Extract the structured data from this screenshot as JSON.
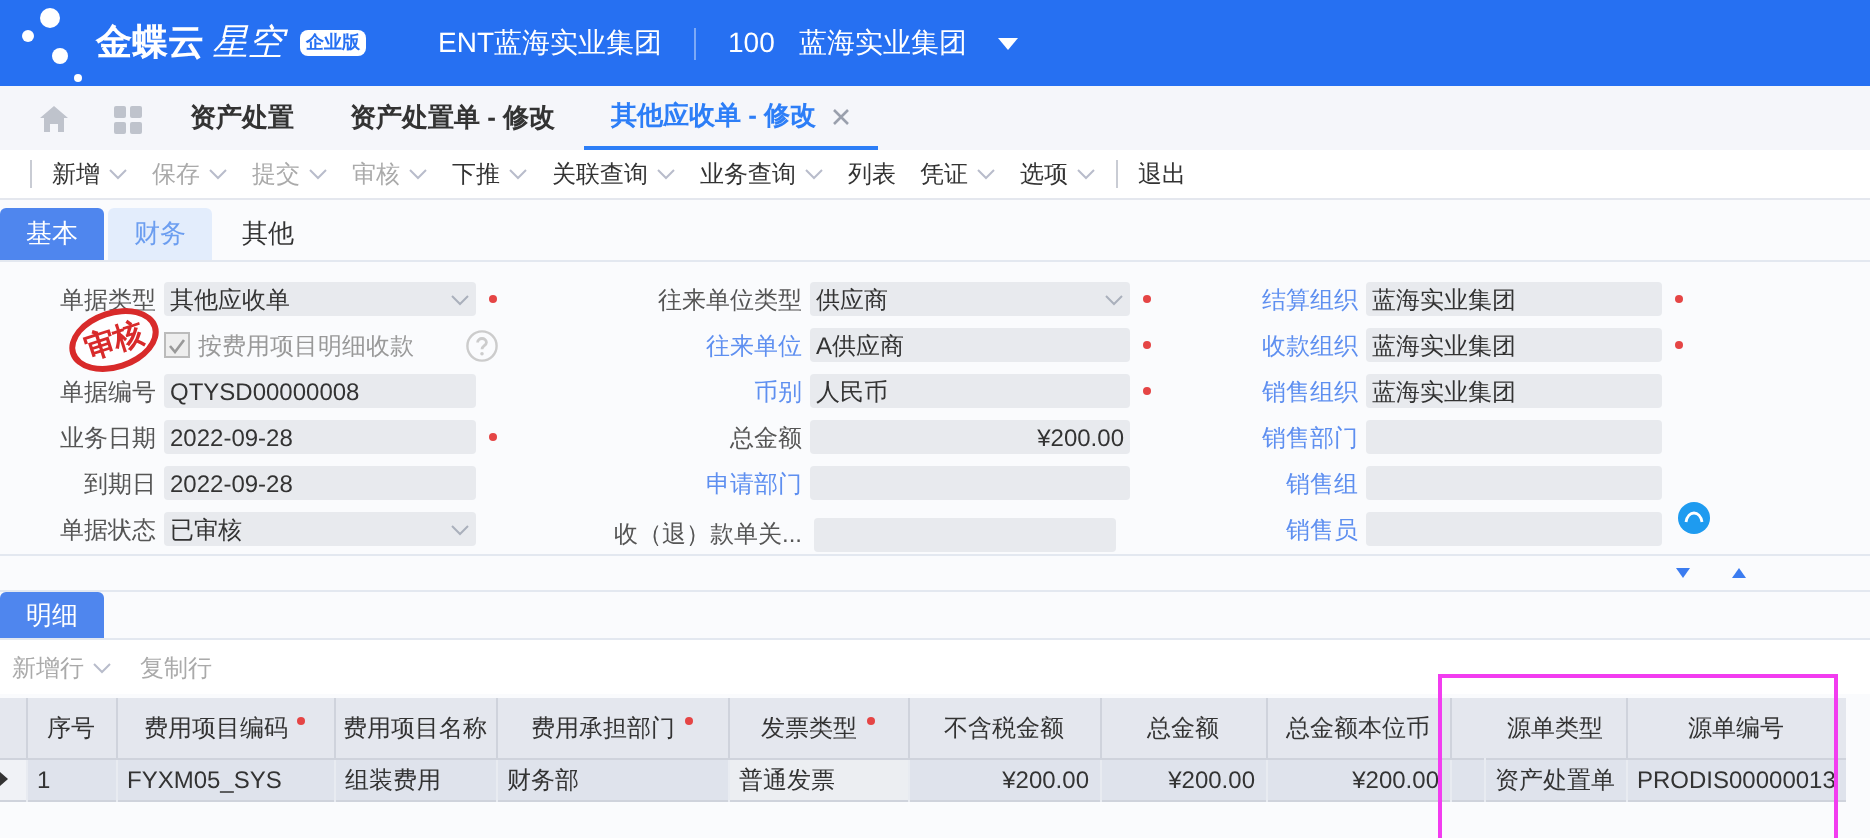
{
  "header": {
    "brand": "金蝶云",
    "product": "星空",
    "edition": "企业版",
    "tenant": "ENT蓝海实业集团",
    "org_code": "100",
    "org_name": "蓝海实业集团"
  },
  "page_tabs": [
    {
      "label": "资产处置",
      "selected": false
    },
    {
      "label": "资产处置单 - 修改",
      "selected": false
    },
    {
      "label": "其他应收单 - 修改",
      "selected": true
    }
  ],
  "toolbar": [
    {
      "label": "新增",
      "disabled": false,
      "dropdown": true
    },
    {
      "label": "保存",
      "disabled": true,
      "dropdown": true
    },
    {
      "label": "提交",
      "disabled": true,
      "dropdown": true
    },
    {
      "label": "审核",
      "disabled": true,
      "dropdown": true
    },
    {
      "label": "下推",
      "disabled": false,
      "dropdown": true
    },
    {
      "label": "关联查询",
      "disabled": false,
      "dropdown": true
    },
    {
      "label": "业务查询",
      "disabled": false,
      "dropdown": true
    },
    {
      "label": "列表",
      "disabled": false,
      "dropdown": false
    },
    {
      "label": "凭证",
      "disabled": false,
      "dropdown": true
    },
    {
      "label": "选项",
      "disabled": false,
      "dropdown": true
    },
    {
      "label": "退出",
      "disabled": false,
      "dropdown": false
    }
  ],
  "form_tabs": [
    {
      "label": "基本",
      "selected": true,
      "hover": false
    },
    {
      "label": "财务",
      "selected": false,
      "hover": true
    },
    {
      "label": "其他",
      "selected": false,
      "hover": false
    }
  ],
  "stamp": "审核",
  "form_columns": [
    [
      {
        "kind": "select",
        "label": "单据类型",
        "link": false,
        "value": "其他应收单",
        "required": true
      },
      {
        "kind": "checkbox",
        "label": "按费用项目明细收款",
        "checked": true
      },
      {
        "kind": "text",
        "label": "单据编号",
        "link": false,
        "value": "QTYSD00000008",
        "required": false
      },
      {
        "kind": "text",
        "label": "业务日期",
        "link": false,
        "value": "2022-09-28",
        "required": true
      },
      {
        "kind": "text",
        "label": "到期日",
        "link": false,
        "value": "2022-09-28",
        "required": false
      },
      {
        "kind": "select",
        "label": "单据状态",
        "link": false,
        "value": "已审核",
        "required": false
      }
    ],
    [
      {
        "kind": "select",
        "label": "往来单位类型",
        "link": false,
        "value": "供应商",
        "required": true
      },
      {
        "kind": "text",
        "label": "往来单位",
        "link": true,
        "value": "A供应商",
        "required": true
      },
      {
        "kind": "text",
        "label": "币别",
        "link": true,
        "value": "人民币",
        "required": true
      },
      {
        "kind": "amount",
        "label": "总金额",
        "link": false,
        "value": "¥200.00",
        "required": false
      },
      {
        "kind": "text",
        "label": "申请部门",
        "link": true,
        "required": false
      },
      {
        "kind": "text",
        "label": "收（退）款单关...",
        "link": false,
        "required": false
      }
    ],
    [
      {
        "kind": "text",
        "label": "结算组织",
        "link": true,
        "value": "蓝海实业集团",
        "required": true
      },
      {
        "kind": "text",
        "label": "收款组织",
        "link": true,
        "value": "蓝海实业集团",
        "required": true
      },
      {
        "kind": "text",
        "label": "销售组织",
        "link": true,
        "value": "蓝海实业集团",
        "required": false
      },
      {
        "kind": "text",
        "label": "销售部门",
        "link": true,
        "required": false
      },
      {
        "kind": "text",
        "label": "销售组",
        "link": true,
        "required": false
      },
      {
        "kind": "text",
        "label": "销售员",
        "link": true,
        "required": false
      }
    ]
  ],
  "detail_tabs": [
    {
      "label": "明细",
      "selected": true
    }
  ],
  "detail_toolbar": [
    {
      "label": "新增行",
      "dropdown": true
    },
    {
      "label": "复制行",
      "dropdown": false
    }
  ],
  "table": {
    "columns": [
      {
        "label": "序号",
        "required": false,
        "kind": "text"
      },
      {
        "label": "费用项目编码",
        "required": true,
        "kind": "text"
      },
      {
        "label": "费用项目名称",
        "required": false,
        "kind": "text"
      },
      {
        "label": "费用承担部门",
        "required": true,
        "kind": "text"
      },
      {
        "label": "发票类型",
        "required": true,
        "kind": "text"
      },
      {
        "label": "不含税金额",
        "required": false,
        "kind": "amount"
      },
      {
        "label": "总金额",
        "required": false,
        "kind": "amount"
      },
      {
        "label": "总金额本位币",
        "required": false,
        "kind": "amount"
      },
      {
        "label": "源单类型",
        "required": false,
        "kind": "text",
        "highlighted": true
      },
      {
        "label": "源单编号",
        "required": false,
        "kind": "text",
        "highlighted": true
      }
    ],
    "rows": [
      {
        "current": true,
        "cells": [
          "1",
          "FYXM05_SYS",
          "组装费用",
          "财务部",
          "普通发票",
          "¥200.00",
          "¥200.00",
          "¥200.00",
          "资产处置单",
          "PRODIS00000013"
        ]
      }
    ]
  }
}
